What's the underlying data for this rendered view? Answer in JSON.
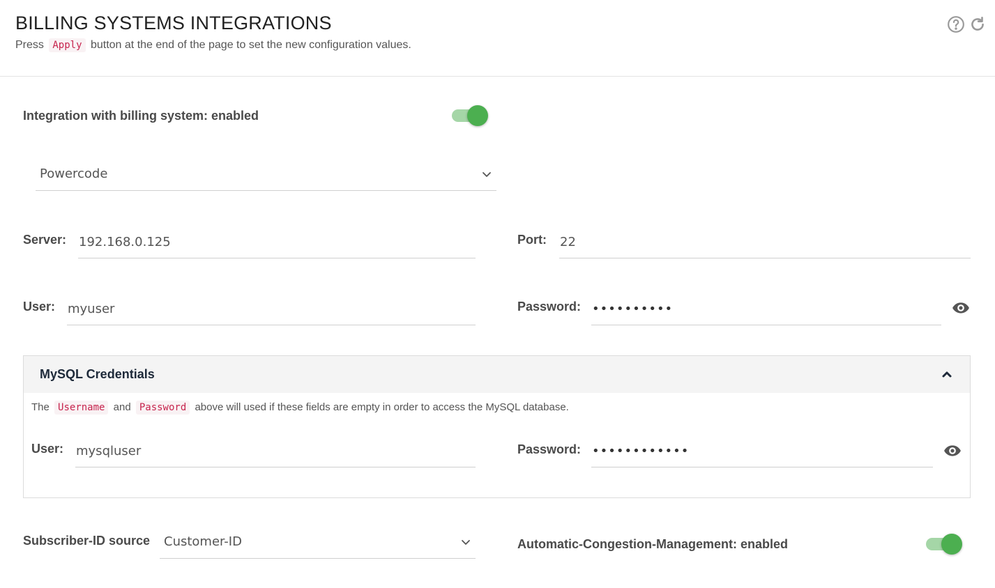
{
  "header": {
    "title": "BILLING SYSTEMS INTEGRATIONS",
    "subtitle_pre": "Press",
    "subtitle_code": "Apply",
    "subtitle_post": "button at the end of the page to set the new configuration values.",
    "help_icon": "help-circle-icon",
    "refresh_icon": "refresh-icon"
  },
  "integration": {
    "label": "Integration with billing system: enabled",
    "enabled": true
  },
  "billing_system": {
    "selected": "Powercode"
  },
  "server": {
    "label": "Server:",
    "value": "192.168.0.125"
  },
  "port": {
    "label": "Port:",
    "value": "22"
  },
  "user": {
    "label": "User:",
    "value": "myuser"
  },
  "password": {
    "label": "Password:",
    "value": "••••••••••"
  },
  "mysql": {
    "title": "MySQL Credentials",
    "note_pre": "The",
    "note_code1": "Username",
    "note_mid": "and",
    "note_code2": "Password",
    "note_post": "above will used if these fields are empty in order to access the MySQL database.",
    "user_label": "User:",
    "user_value": "mysqluser",
    "password_label": "Password:",
    "password_value": "••••••••••••"
  },
  "subscriber": {
    "label": "Subscriber-ID source",
    "selected": "Customer-ID"
  },
  "congestion": {
    "label": "Automatic-Congestion-Management: enabled",
    "enabled": true
  },
  "colors": {
    "toggle_on": "#4caf50",
    "toggle_track": "#a5d6a7",
    "code_text": "#c7254e",
    "code_bg": "#f9f2f4"
  }
}
